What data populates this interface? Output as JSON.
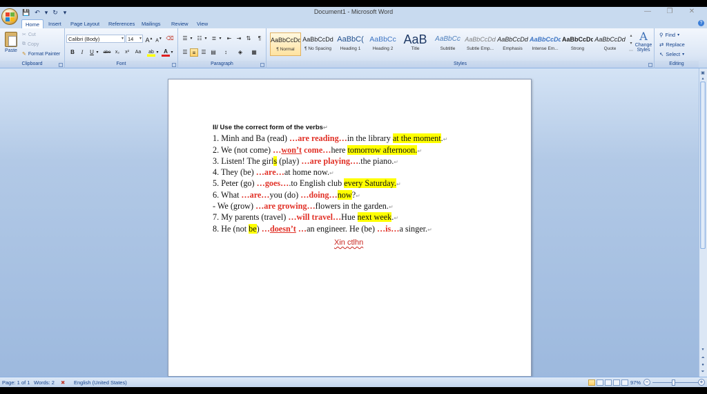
{
  "window": {
    "title": "Document1 - Microsoft Word",
    "controls": {
      "minimize": "—",
      "restore": "❐",
      "close": "✕"
    }
  },
  "quick_access": {
    "save": "💾",
    "undo": "↶",
    "undo_dd": "▾",
    "redo": "↻",
    "customize": "▾"
  },
  "tabs": [
    {
      "label": "Home",
      "active": true
    },
    {
      "label": "Insert"
    },
    {
      "label": "Page Layout"
    },
    {
      "label": "References"
    },
    {
      "label": "Mailings"
    },
    {
      "label": "Review"
    },
    {
      "label": "View"
    }
  ],
  "ribbon": {
    "clipboard": {
      "label": "Clipboard",
      "paste": "Paste",
      "cut": "Cut",
      "copy": "Copy",
      "format_painter": "Format Painter"
    },
    "font": {
      "label": "Font",
      "name": "Calibri (Body)",
      "size": "14",
      "grow": "A",
      "shrink": "A",
      "bold": "B",
      "italic": "I",
      "underline": "U",
      "strike": "abe",
      "subscript": "x₂",
      "superscript": "x²",
      "change_case": "Aa",
      "highlight": "ab",
      "font_color": "A"
    },
    "paragraph": {
      "label": "Paragraph"
    },
    "styles": {
      "label": "Styles",
      "items": [
        {
          "sample": "AaBbCcDd",
          "name": "¶ Normal",
          "active": true
        },
        {
          "sample": "AaBbCcDd",
          "name": "¶ No Spacing"
        },
        {
          "sample": "AaBbC(",
          "name": "Heading 1"
        },
        {
          "sample": "AaBbCc",
          "name": "Heading 2"
        },
        {
          "sample": "AaB",
          "name": "Title"
        },
        {
          "sample": "AaBbCc",
          "name": "Subtitle"
        },
        {
          "sample": "AaBbCcDd",
          "name": "Subtle Emp..."
        },
        {
          "sample": "AaBbCcDd",
          "name": "Emphasis"
        },
        {
          "sample": "AaBbCcDd",
          "name": "Intense Em..."
        },
        {
          "sample": "AaBbCcDd",
          "name": "Strong"
        },
        {
          "sample": "AaBbCcDd",
          "name": "Quote"
        }
      ],
      "change_styles_line1": "Change",
      "change_styles_line2": "Styles"
    },
    "editing": {
      "label": "Editing",
      "find": "Find",
      "replace": "Replace",
      "select": "Select"
    }
  },
  "document": {
    "heading": "II/ Use the correct form of the verbs",
    "lines": [
      {
        "before": "1. Minh and Ba (read) ",
        "ans": "…are reading…",
        "after": "in the library ",
        "hl": "at the moment",
        "end": "."
      },
      {
        "before": "2. We (not come) ",
        "ans_pre": "…",
        "ans": "won’t",
        "ans_post": " come…",
        "after": "here ",
        "hl": "tomorrow afternoon.",
        "end": ""
      },
      {
        "before": "3. Listen! The girl",
        "hl_mid": "s",
        "mid": " (play) ",
        "ans": "…are playing…",
        "after": ".the piano.",
        "end": ""
      },
      {
        "before": "4. They (be) ",
        "ans": "…are…",
        "after": "at home now.",
        "end": ""
      },
      {
        "before": "5. Peter (go) ",
        "ans": "…goes…",
        "after": ".to English club ",
        "hl": "every Saturday.",
        "end": ""
      },
      {
        "before": "6. What ",
        "ans": "…are…",
        "after": "you (do) ",
        "ans2": "…doing…",
        "hl": "now",
        "end": "?"
      },
      {
        "before": "- We (grow) ",
        "ans": "…are growing…",
        "after": "flowers in the garden.",
        "end": ""
      },
      {
        "before": "7. My parents (travel) ",
        "ans": "…will travel…",
        "after": "Hue ",
        "hl": "next week",
        "end": "."
      },
      {
        "before": "8. He (not ",
        "hl_mid": "be",
        "mid": ") ",
        "ans_pre": "…",
        "ans": "doesn’t",
        "ans_post": " …",
        "after": "an engineer. He (be) ",
        "ans2": "…is…",
        "after2": "a singer.",
        "end": ""
      }
    ],
    "note": "Xin ctlhn"
  },
  "statusbar": {
    "page": "Page: 1 of 1",
    "words": "Words: 2",
    "language": "English (United States)",
    "zoom": "97%",
    "zoom_minus": "−",
    "zoom_plus": "+"
  },
  "colors": {
    "answer": "#e13127",
    "highlight": "#ffff00",
    "ribbon_text": "#15428b"
  }
}
